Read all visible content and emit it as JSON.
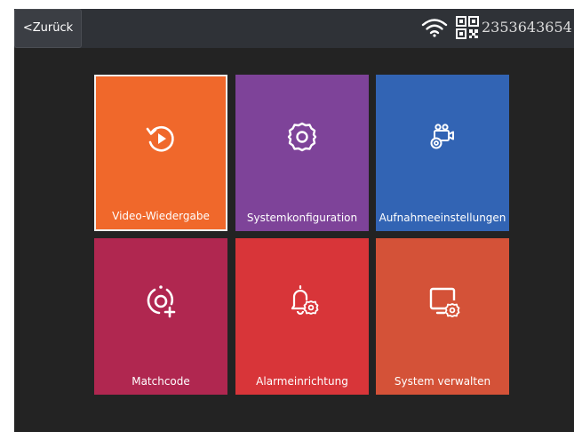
{
  "topbar": {
    "back_label": "<Zurück",
    "device_id": "2353643654"
  },
  "tiles": [
    {
      "label": "Video-Wiedergabe",
      "icon": "playback-icon",
      "color": "#f0682b",
      "selected": true
    },
    {
      "label": "Systemkonfiguration",
      "icon": "gear-icon",
      "color": "#7e4399",
      "selected": false
    },
    {
      "label": "Aufnahmeeinstellungen",
      "icon": "camera-settings-icon",
      "color": "#3264b4",
      "selected": false
    },
    {
      "label": "Matchcode",
      "icon": "add-device-icon",
      "color": "#b02750",
      "selected": false
    },
    {
      "label": "Alarmeinrichtung",
      "icon": "alarm-bell-icon",
      "color": "#d83539",
      "selected": false
    },
    {
      "label": "System verwalten",
      "icon": "system-manage-icon",
      "color": "#d45238",
      "selected": false
    }
  ]
}
